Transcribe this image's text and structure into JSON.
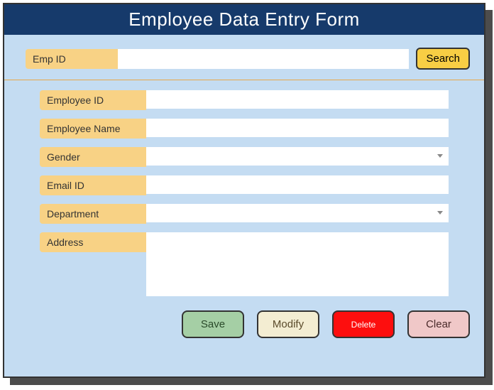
{
  "header": {
    "title": "Employee Data Entry Form"
  },
  "search": {
    "label": "Emp ID",
    "value": "",
    "button": "Search"
  },
  "fields": {
    "empId": {
      "label": "Employee ID",
      "value": ""
    },
    "empName": {
      "label": "Employee Name",
      "value": ""
    },
    "gender": {
      "label": "Gender",
      "value": ""
    },
    "email": {
      "label": "Email ID",
      "value": ""
    },
    "department": {
      "label": "Department",
      "value": ""
    },
    "address": {
      "label": "Address",
      "value": ""
    }
  },
  "buttons": {
    "save": "Save",
    "modify": "Modify",
    "delete": "Delete",
    "clear": "Clear"
  }
}
